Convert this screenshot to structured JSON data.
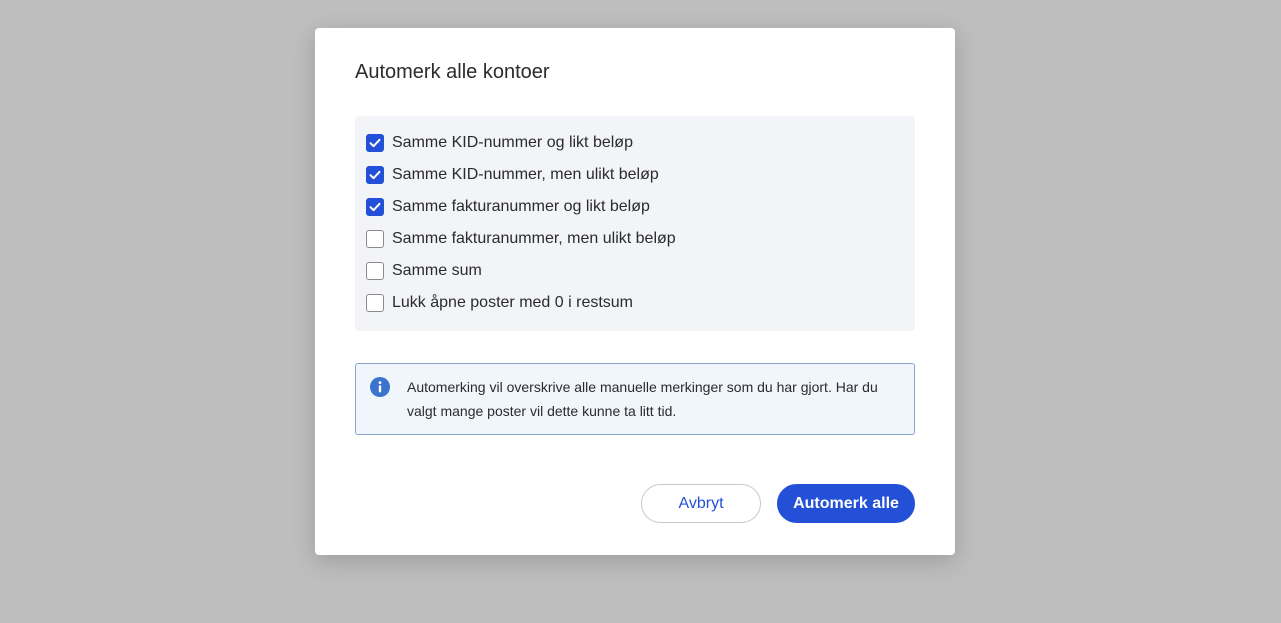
{
  "dialog": {
    "title": "Automerk alle kontoer",
    "options": [
      {
        "label": "Samme KID-nummer og likt beløp",
        "checked": true
      },
      {
        "label": "Samme KID-nummer, men ulikt beløp",
        "checked": true
      },
      {
        "label": "Samme fakturanummer og likt beløp",
        "checked": true
      },
      {
        "label": "Samme fakturanummer, men ulikt beløp",
        "checked": false
      },
      {
        "label": "Samme sum",
        "checked": false
      },
      {
        "label": "Lukk åpne poster med 0 i restsum",
        "checked": false
      }
    ],
    "info": {
      "icon": "info-icon",
      "text": "Automerking vil overskrive alle manuelle merkinger som du har gjort. Har du valgt mange poster vil dette kunne ta litt tid."
    },
    "buttons": {
      "cancel_label": "Avbryt",
      "confirm_label": "Automerk alle"
    }
  },
  "colors": {
    "accent": "#2450d8",
    "backdrop": "#bebebe",
    "options_background": "#f2f4f7",
    "info_background": "#f1f6fd",
    "info_border": "#86a6cc",
    "info_icon": "#3a74cc"
  }
}
